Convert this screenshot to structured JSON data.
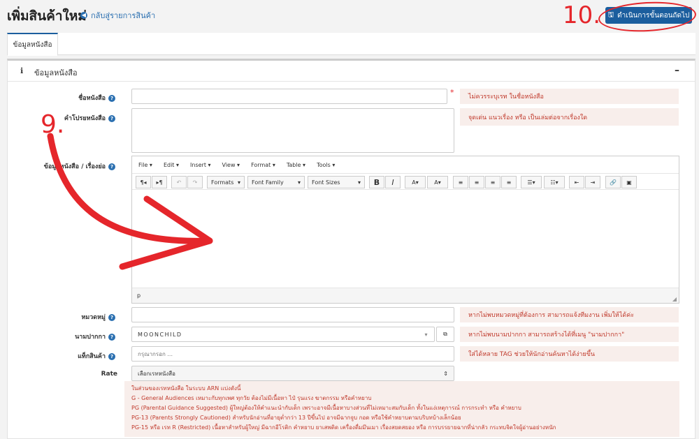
{
  "header": {
    "title": "เพิ่มสินค้าใหม่",
    "back_link": "กลับสู่รายการสินค้า",
    "next_button": "ดำเนินการขั้นตอนถัดไป"
  },
  "annotations": {
    "step10": "10.",
    "step9": "9."
  },
  "tabs": [
    {
      "label": "ข้อมูลหนังสือ"
    }
  ],
  "panel": {
    "title": "ข้อมูลหนังสือ",
    "collapse_symbol": "–"
  },
  "form": {
    "book_name": {
      "label": "ชื่อหนังสือ",
      "value": "",
      "required": "*",
      "hint": "ไม่ควรระบุเรท ในชื่อหนังสือ"
    },
    "tagline": {
      "label": "คำโปรยหนังสือ",
      "value": "",
      "hint": "จุดเด่น แนวเรื่อง หรือ เป็นเล่มต่อจากเรื่องใด"
    },
    "synopsis": {
      "label": "ข้อมูลหนังสือ / เรื่องย่อ"
    },
    "category": {
      "label": "หมวดหมู่",
      "value": "",
      "hint": "หากไม่พบหมวดหมู่ที่ต้องการ สามารถแจ้งทีมงาน เพิ่มให้ได้ค่ะ"
    },
    "pen_name": {
      "label": "นามปากกา",
      "value": "MOONCHILD",
      "hint": "หากไม่พบนามปากกา สามารถสร้างได้ที่เมนู \"นามปากกา\""
    },
    "tags": {
      "label": "แท็กสินค้า",
      "placeholder": "กรุณากรอก ...",
      "hint": "ใส่ได้หลาย TAG ช่วยให้นักอ่านค้นหาได้ง่ายขึ้น"
    },
    "rate": {
      "label": "Rate",
      "value": "เลือกเรทหนังสือ"
    }
  },
  "editor": {
    "menus": [
      "File ▾",
      "Edit ▾",
      "Insert ▾",
      "View ▾",
      "Format ▾",
      "Table ▾",
      "Tools ▾"
    ],
    "formats_label": "Formats",
    "font_family_label": "Font Family",
    "font_sizes_label": "Font Sizes",
    "status_path": "p"
  },
  "rate_info": [
    "ในส่วนของเรทหนังสือ ในระบบ ARN แบ่งดังนี้",
    "G - General Audiences เหมาะกับทุกเพศ ทุกวัย ต้องไม่มีเนื้อหา ไป๋ รุนแรง ฆาตกรรม หรือคำหยาบ",
    "PG (Parental Guidance Suggested) ผู้ใหญ่ต้องให้คำแนะนำกับเด็ก เพราะอาจมีเนื้อหาบางส่วนที่ไม่เหมาะสมกับเด็ก ทั้งในแง่เหตุการณ์ การกระทำ หรือ คำหยาบ",
    "PG-13 (Parents Strongly Cautioned) สำหรับนักอ่านที่อายุต่ำกว่า 13 ปีขึ้นไป อาจมีฉากจูบ กอด หรือใช้คำหยาบตามบริบทบ้างเล็กน้อย",
    "PG-15 หรือ เรท R (Restricted) เนื้อหาสำหรับผู้ใหญ่ มีฉากอีโรติก คำหยาบ ยาเสพติด เครื่องดื่มมึนเมา เรื่องสยดสยอง หรือ การบรรยายฉากที่น่ากลัว กระทบจิตใจผู้อ่านอย่างหนัก"
  ]
}
